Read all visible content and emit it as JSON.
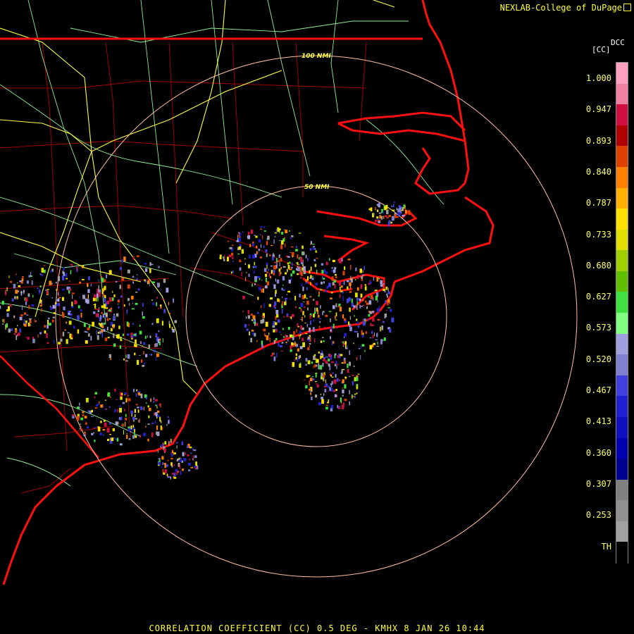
{
  "header": {
    "credit": "NEXLAB-College of DuPage",
    "credit_icon": "external-link-icon"
  },
  "legend": {
    "product_code": "DCC",
    "unit": "[CC]",
    "labels": [
      "1.000",
      "0.947",
      "0.893",
      "0.840",
      "0.787",
      "0.733",
      "0.680",
      "0.627",
      "0.573",
      "0.520",
      "0.467",
      "0.413",
      "0.360",
      "0.307",
      "0.253",
      "TH"
    ],
    "stops": [
      "#ff9fbf",
      "#f080a0",
      "#d01040",
      "#b00000",
      "#e04000",
      "#ff8000",
      "#ffb000",
      "#ffe000",
      "#e0e000",
      "#a0d000",
      "#60c000",
      "#40e040",
      "#80ff80",
      "#a0a0e0",
      "#8080d0",
      "#4040e0",
      "#2020d0",
      "#1010c0",
      "#0000b0",
      "#000090",
      "#808080",
      "#909090",
      "#a0a0a0",
      "#000000"
    ]
  },
  "map": {
    "range_rings": [
      {
        "label": "50 NMI"
      },
      {
        "label": "100 NMI"
      }
    ],
    "colors": {
      "coast": "#ff1010",
      "county": "#b00000",
      "highway": "#ffff40",
      "road": "#90ee90",
      "ring": "#ffc0a0"
    }
  },
  "footer": {
    "caption": "CORRELATION COEFFICIENT (CC) 0.5 DEG - KMHX 8 JAN 26 10:44"
  }
}
